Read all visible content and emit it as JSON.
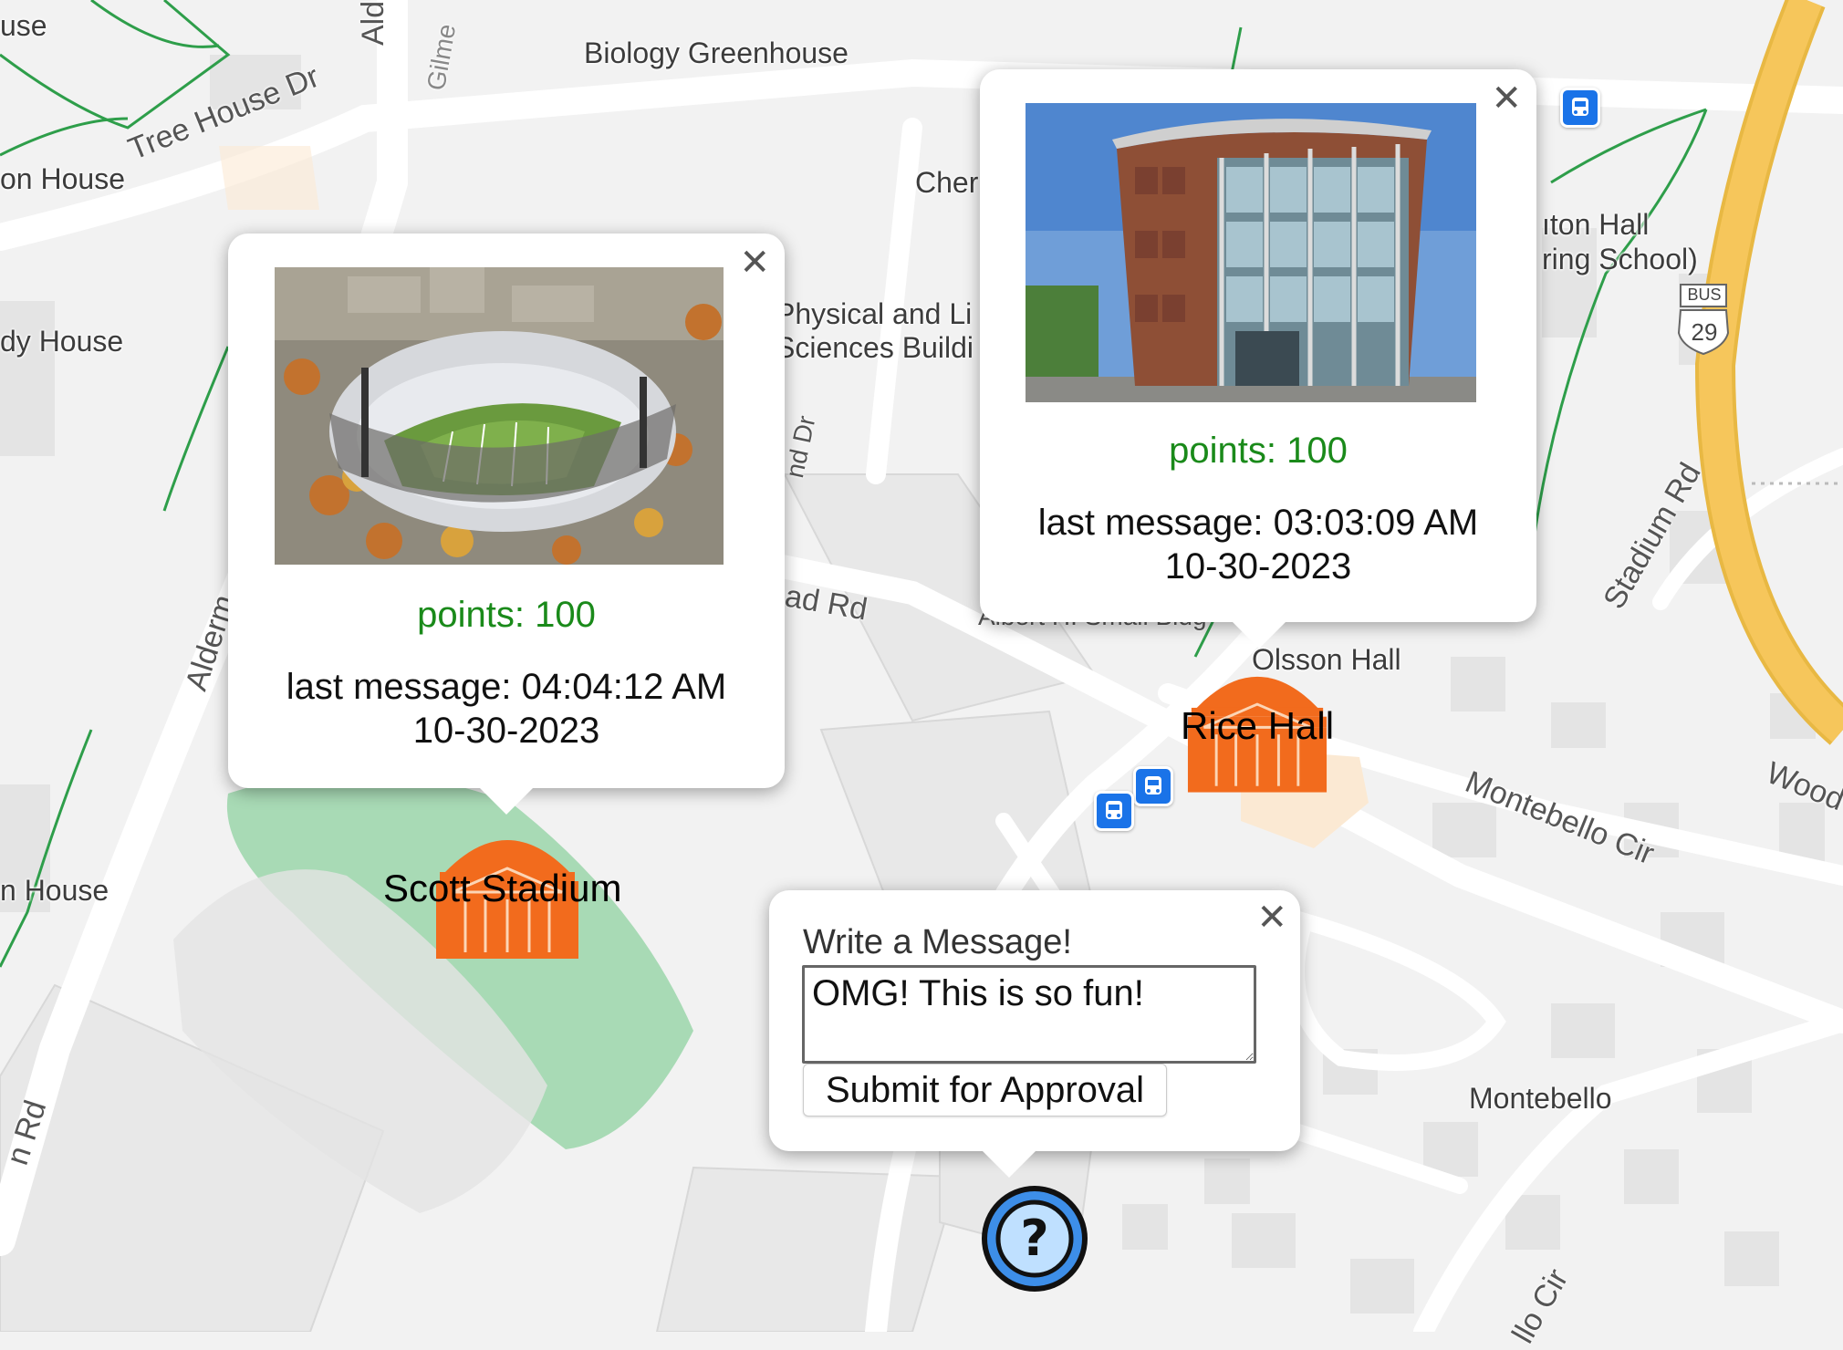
{
  "map": {
    "place_labels": [
      {
        "id": "use",
        "text": "use"
      },
      {
        "id": "biology",
        "text": "Biology Greenhouse"
      },
      {
        "id": "tree-house-dr",
        "text": "Tree House Dr"
      },
      {
        "id": "on-house-1",
        "text": "on House"
      },
      {
        "id": "dy-house",
        "text": "dy House"
      },
      {
        "id": "physical",
        "text": "Physical and Li"
      },
      {
        "id": "sciences",
        "text": "Sciences Buildi"
      },
      {
        "id": "cher",
        "text": "Cher"
      },
      {
        "id": "aton-hall",
        "text": "ıton Hall"
      },
      {
        "id": "ring-school",
        "text": "ring School)"
      },
      {
        "id": "olsson",
        "text": "Olsson Hall"
      },
      {
        "id": "on-house-2",
        "text": "n House"
      },
      {
        "id": "montebello",
        "text": "Montebello"
      },
      {
        "id": "ad-rd",
        "text": "ad Rd"
      },
      {
        "id": "albert",
        "text": "Albert H. Small Bldg"
      }
    ],
    "road_labels": [
      {
        "id": "alde",
        "text": "Alde"
      },
      {
        "id": "gilme",
        "text": "Gilme"
      },
      {
        "id": "alderm",
        "text": "Alderm"
      },
      {
        "id": "stadium-rd",
        "text": "Stadium Rd"
      },
      {
        "id": "montebello-cir",
        "text": "Montebello Cir"
      },
      {
        "id": "wood",
        "text": "Wood"
      },
      {
        "id": "nd-dr",
        "text": "nd Dr"
      },
      {
        "id": "rd-left",
        "text": "n Rd"
      },
      {
        "id": "llo-cir",
        "text": "llo Cir"
      }
    ],
    "route_shield": {
      "top": "BUS",
      "number": "29"
    },
    "colors": {
      "background": "#f2f2f2",
      "road": "#ffffff",
      "highway": "#f6c65b",
      "trail": "#2e9e4a",
      "field": "#a8dab5",
      "bus": "#1a73e8"
    }
  },
  "markers": {
    "scott": {
      "label": "Scott Stadium",
      "icon": "rotunda-icon"
    },
    "rice": {
      "label": "Rice Hall",
      "icon": "rotunda-icon"
    },
    "unknown": {
      "icon": "question-mark-icon"
    }
  },
  "popups": {
    "scott": {
      "close": "✕",
      "points": "points: 100",
      "last_message_line1": "last message: 04:04:12 AM",
      "last_message_line2": "10-30-2023"
    },
    "rice": {
      "close": "✕",
      "points": "points: 100",
      "last_message_line1": "last message: 03:03:09 AM",
      "last_message_line2": "10-30-2023"
    },
    "message": {
      "close": "✕",
      "title": "Write a Message!",
      "input_value": "OMG! This is so fun!",
      "submit_label": "Submit for Approval"
    }
  }
}
